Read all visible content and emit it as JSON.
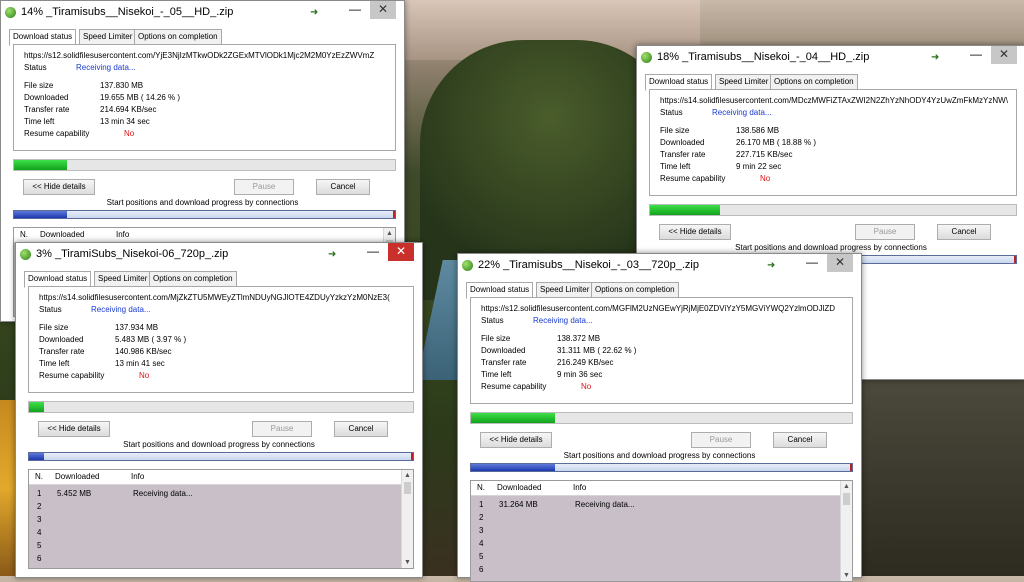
{
  "labels": {
    "tab_status": "Download status",
    "tab_speed": "Speed Limiter",
    "tab_options": "Options on completion",
    "status": "Status",
    "file_size": "File size",
    "downloaded": "Downloaded",
    "transfer_rate": "Transfer rate",
    "time_left": "Time left",
    "resume": "Resume capability",
    "hide_details": "<< Hide details",
    "pause": "Pause",
    "cancel": "Cancel",
    "connections_title": "Start positions and download progress by connections",
    "col_n": "N.",
    "col_downloaded": "Downloaded",
    "col_info": "Info"
  },
  "windows": [
    {
      "title": "14% _Tiramisubs__Nisekoi_-_05__HD_.zip",
      "url": "https://s12.solidfilesusercontent.com/YjE3NjIzMTkwODk2ZGExMTVlODk1Mjc2M2M0YzEzZWVmZ",
      "status": "Receiving data...",
      "file_size": "137.830  MB",
      "downloaded": "19.655  MB  ( 14.26 % )",
      "transfer_rate": "214.694  KB/sec",
      "time_left": "13 min 34 sec",
      "resume": "No",
      "progress": 0.14,
      "conn_progress": 0.14,
      "rows": []
    },
    {
      "title": "18% _Tiramisubs__Nisekoi_-_04__HD_.zip",
      "url": "https://s14.solidfilesusercontent.com/MDczMWFiZTAxZWI2N2ZhYzNhODY4YzUwZmFkMzYzNW\\",
      "status": "Receiving data...",
      "file_size": "138.586  MB",
      "downloaded": "26.170  MB  ( 18.88 % )",
      "transfer_rate": "227.715  KB/sec",
      "time_left": "9 min 22 sec",
      "resume": "No",
      "progress": 0.19,
      "conn_progress": 0.19,
      "rows": []
    },
    {
      "title": "3% _TiramiSubs_Nisekoi-06_720p_.zip",
      "url": "https://s14.solidfilesusercontent.com/MjZkZTU5MWEyZTlmNDUyNGJlOTE4ZDUyYzkzYzM0NzE3(",
      "status": "Receiving data...",
      "file_size": "137.934  MB",
      "downloaded": "5.483  MB  ( 3.97 % )",
      "transfer_rate": "140.986  KB/sec",
      "time_left": "13 min 41 sec",
      "resume": "No",
      "progress": 0.04,
      "conn_progress": 0.04,
      "rows": [
        {
          "n": "1",
          "downloaded": "5.452  MB",
          "info": "Receiving data..."
        },
        {
          "n": "2",
          "downloaded": "",
          "info": ""
        },
        {
          "n": "3",
          "downloaded": "",
          "info": ""
        },
        {
          "n": "4",
          "downloaded": "",
          "info": ""
        },
        {
          "n": "5",
          "downloaded": "",
          "info": ""
        },
        {
          "n": "6",
          "downloaded": "",
          "info": ""
        }
      ]
    },
    {
      "title": "22% _Tiramisubs__Nisekoi_-_03__720p_.zip",
      "url": "https://s12.solidfilesusercontent.com/MGFlM2UzNGEwYjRjMjE0ZDViYzY5MGViYWQ2YzlmODJlZD",
      "status": "Receiving data...",
      "file_size": "138.372  MB",
      "downloaded": "31.311  MB  ( 22.62 % )",
      "transfer_rate": "216.249  KB/sec",
      "time_left": "9 min 36 sec",
      "resume": "No",
      "progress": 0.22,
      "conn_progress": 0.22,
      "rows": [
        {
          "n": "1",
          "downloaded": "31.264  MB",
          "info": "Receiving data..."
        },
        {
          "n": "2",
          "downloaded": "",
          "info": ""
        },
        {
          "n": "3",
          "downloaded": "",
          "info": ""
        },
        {
          "n": "4",
          "downloaded": "",
          "info": ""
        },
        {
          "n": "5",
          "downloaded": "",
          "info": ""
        },
        {
          "n": "6",
          "downloaded": "",
          "info": ""
        }
      ]
    }
  ],
  "colors": {
    "progress_green": "#12a21c",
    "status_blue": "#1a3bd0",
    "resume_red": "#e01010",
    "close_active": "#c9302c"
  },
  "icons": [
    "download-globe-icon",
    "download-arrow-icon",
    "minimize-icon",
    "close-icon"
  ]
}
